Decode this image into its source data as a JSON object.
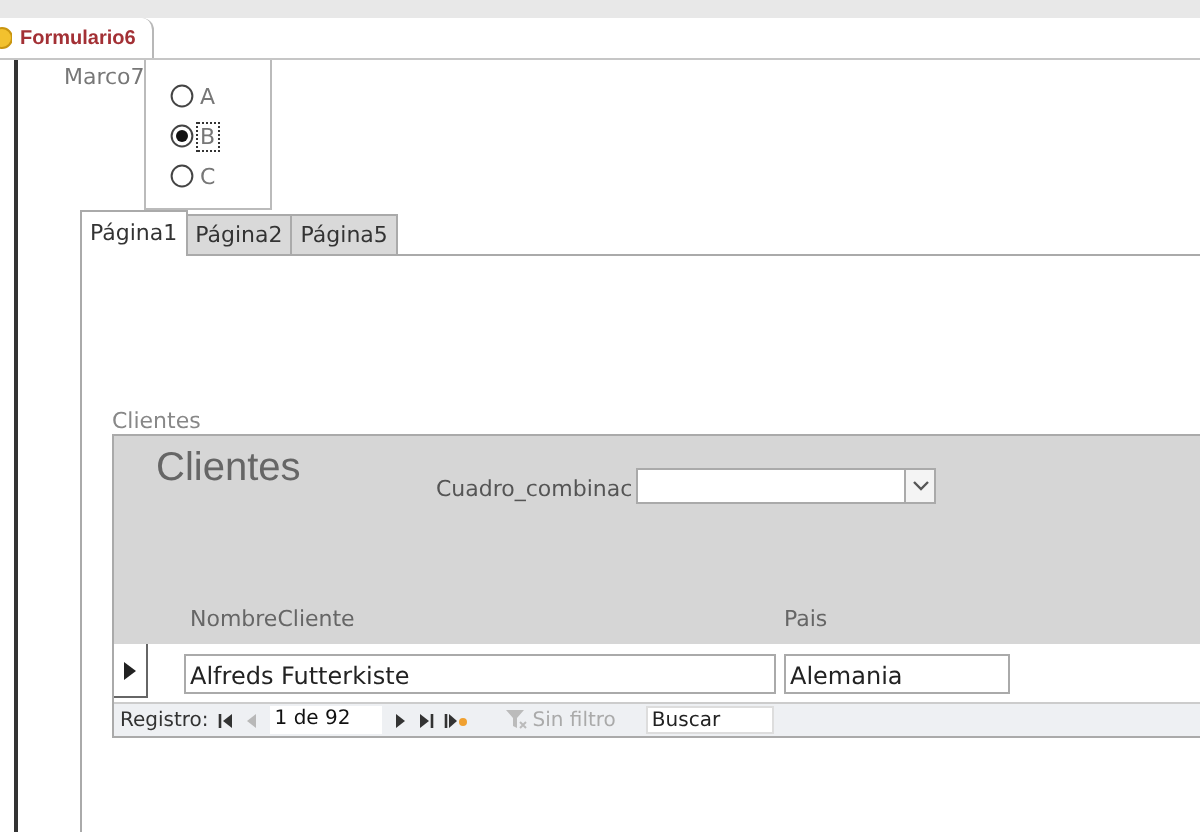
{
  "document_tab": {
    "title": "Formulario6"
  },
  "option_group": {
    "label": "Marco7",
    "options": [
      {
        "label": "A",
        "selected": false,
        "focused": false
      },
      {
        "label": "B",
        "selected": true,
        "focused": true
      },
      {
        "label": "C",
        "selected": false,
        "focused": false
      }
    ]
  },
  "tabs": [
    {
      "label": "Página1",
      "selected": true
    },
    {
      "label": "Página2",
      "selected": false
    },
    {
      "label": "Página5",
      "selected": false
    }
  ],
  "subform": {
    "label": "Clientes",
    "title": "Clientes",
    "combo_label": "Cuadro_combinac",
    "columns": [
      "NombreCliente",
      "Pais"
    ],
    "rows": [
      {
        "current": true,
        "cells": [
          "Alfreds Futterkiste",
          "Alemania"
        ]
      }
    ],
    "navigation": {
      "label": "Registro:",
      "position": "1 de 92",
      "filter": "Sin filtro",
      "filter_active": false,
      "search_placeholder": "Buscar",
      "buttons": [
        {
          "kind": "first",
          "disabled": false
        },
        {
          "kind": "previous",
          "disabled": true
        },
        {
          "kind": "next",
          "disabled": false
        },
        {
          "kind": "last",
          "disabled": false
        },
        {
          "kind": "new",
          "disabled": false
        }
      ]
    }
  }
}
